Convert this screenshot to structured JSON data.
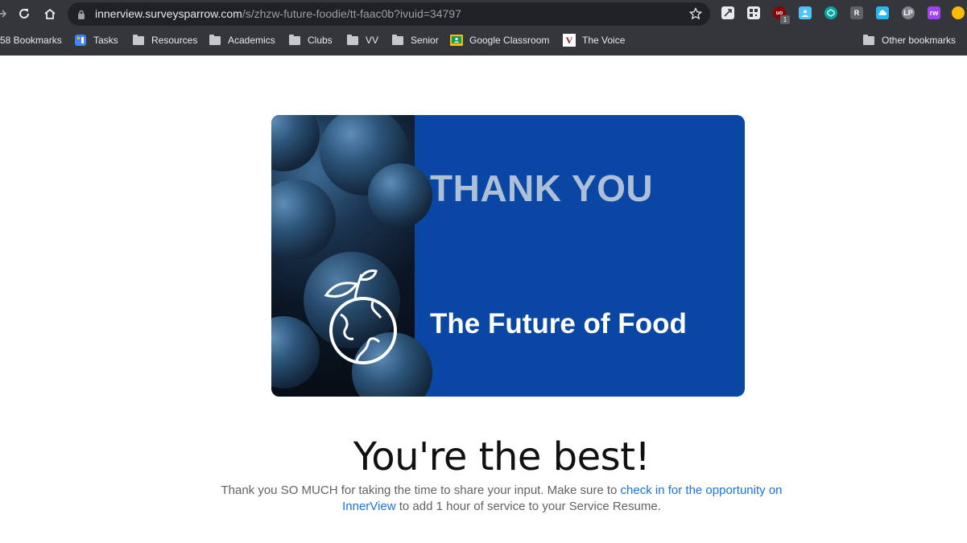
{
  "browser": {
    "url_host": "innerview.surveysparrow.com",
    "url_path": "/s/zhzw-future-foodie/tt-faac0b?ivuid=34797",
    "extension_badge": "1",
    "extensions": [
      {
        "name": "r-icon",
        "glyph": "R",
        "color": "#5f6368"
      },
      {
        "name": "lp-icon",
        "glyph": "LP",
        "color": "#80868b"
      },
      {
        "name": "rw-icon",
        "glyph": "rw",
        "color": "#a142f4"
      }
    ]
  },
  "bookmarks": {
    "items": [
      {
        "label": "58 Bookmarks",
        "icon": "none"
      },
      {
        "label": "Tasks",
        "icon": "tasks-icon"
      },
      {
        "label": "Resources",
        "icon": "folder-icon"
      },
      {
        "label": "Academics",
        "icon": "folder-icon"
      },
      {
        "label": "Clubs",
        "icon": "folder-icon"
      },
      {
        "label": "VV",
        "icon": "folder-icon"
      },
      {
        "label": "Senior",
        "icon": "folder-icon"
      },
      {
        "label": "Google Classroom",
        "icon": "google-classroom-icon"
      },
      {
        "label": "The Voice",
        "icon": "the-voice-icon"
      }
    ],
    "other": "Other bookmarks"
  },
  "banner": {
    "title": "THANK YOU",
    "subtitle": "The Future of Food",
    "bg_color": "#0a46a3"
  },
  "content": {
    "headline": "You're the best!",
    "text_before": "Thank you SO MUCH for taking the time to share your input. Make sure to ",
    "link_text": "check in for the opportunity on InnerView",
    "text_after": " to add 1 hour of service to your Service Resume.",
    "link_color": "#1a73e8"
  }
}
